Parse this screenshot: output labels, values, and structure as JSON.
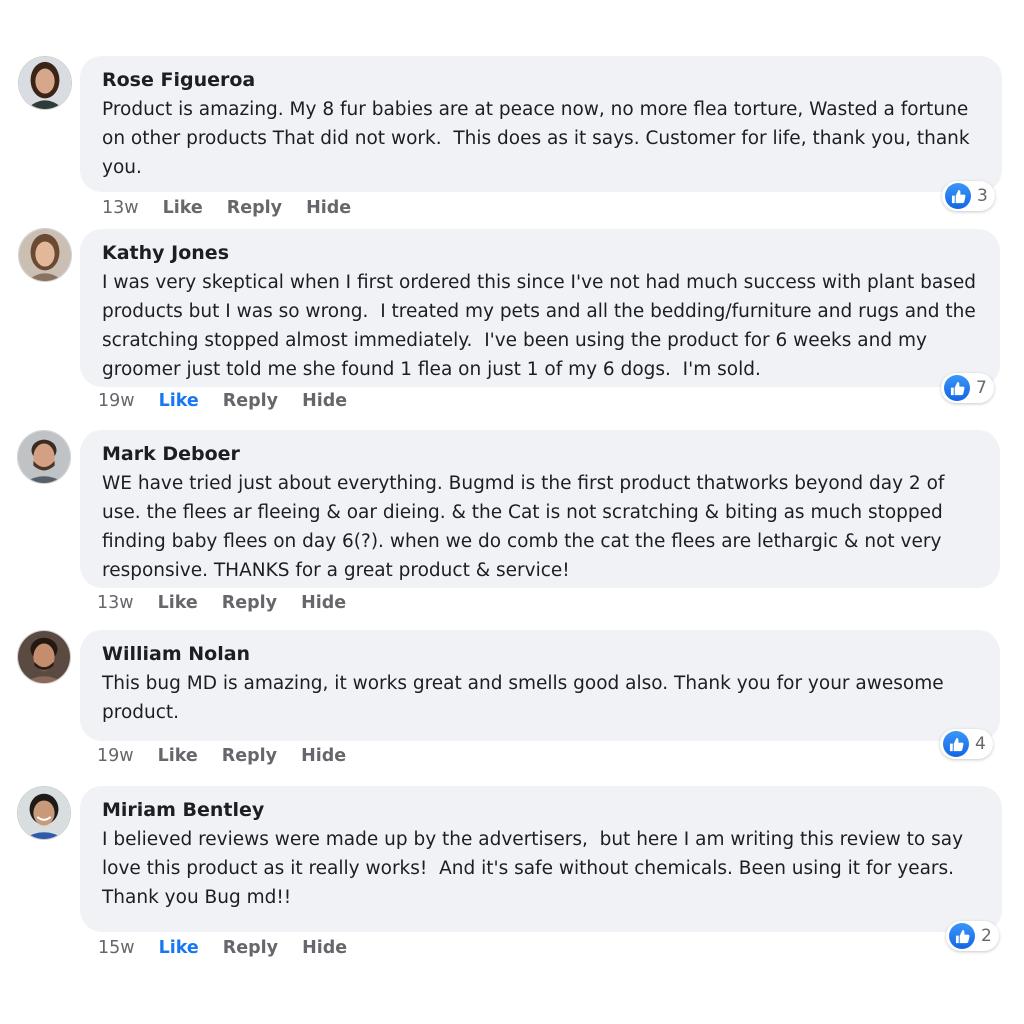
{
  "comments": [
    {
      "author": "Rose Figueroa",
      "text": "Product is amazing. My 8 fur babies are at peace now, no more flea torture, Wasted a fortune on other products That did not work.  This does as it says. Customer for life, thank you, thank you.",
      "time": "13w",
      "like_label": "Like",
      "reply_label": "Reply",
      "hide_label": "Hide",
      "liked": false,
      "reactions": "3"
    },
    {
      "author": "Kathy Jones",
      "text": "I was very skeptical when I first ordered this since I've not had much success with plant based products but I was so wrong.  I treated my pets and all the bedding/furniture and rugs and the scratching stopped almost immediately.  I've been using the product for 6 weeks and my groomer just told me she found 1 flea on just 1 of my 6 dogs.  I'm sold.",
      "time": "19w",
      "like_label": "Like",
      "reply_label": "Reply",
      "hide_label": "Hide",
      "liked": true,
      "reactions": "7"
    },
    {
      "author": "Mark Deboer",
      "text": "WE have tried just about everything. Bugmd is the first product thatworks beyond day 2 of use. the flees ar fleeing & oar dieing. & the Cat is not scratching & biting as much stopped finding baby flees on day 6(?). when we do comb the cat the flees are lethargic & not very responsive. THANKS for a great product & service!",
      "time": "13w",
      "like_label": "Like",
      "reply_label": "Reply",
      "hide_label": "Hide",
      "liked": false,
      "reactions": ""
    },
    {
      "author": "William Nolan",
      "text": "This bug MD is amazing, it works great and smells good also. Thank you for your awesome product.",
      "time": "19w",
      "like_label": "Like",
      "reply_label": "Reply",
      "hide_label": "Hide",
      "liked": false,
      "reactions": "4"
    },
    {
      "author": "Miriam Bentley",
      "text": "I believed reviews were made up by the advertisers,  but here I am writing this review to say love this product as it really works!  And it's safe without chemicals. Been using it for years. Thank you Bug md!!",
      "time": "15w",
      "like_label": "Like",
      "reply_label": "Reply",
      "hide_label": "Hide",
      "liked": true,
      "reactions": "2"
    }
  ],
  "colors": {
    "bubble": "#f0f2f5",
    "meta_text": "#65676b",
    "liked_blue": "#1877f2",
    "reaction_blue": "#1877f2"
  },
  "icons": {
    "reaction": "thumbs-up-icon",
    "avatar": "avatar-photo"
  }
}
